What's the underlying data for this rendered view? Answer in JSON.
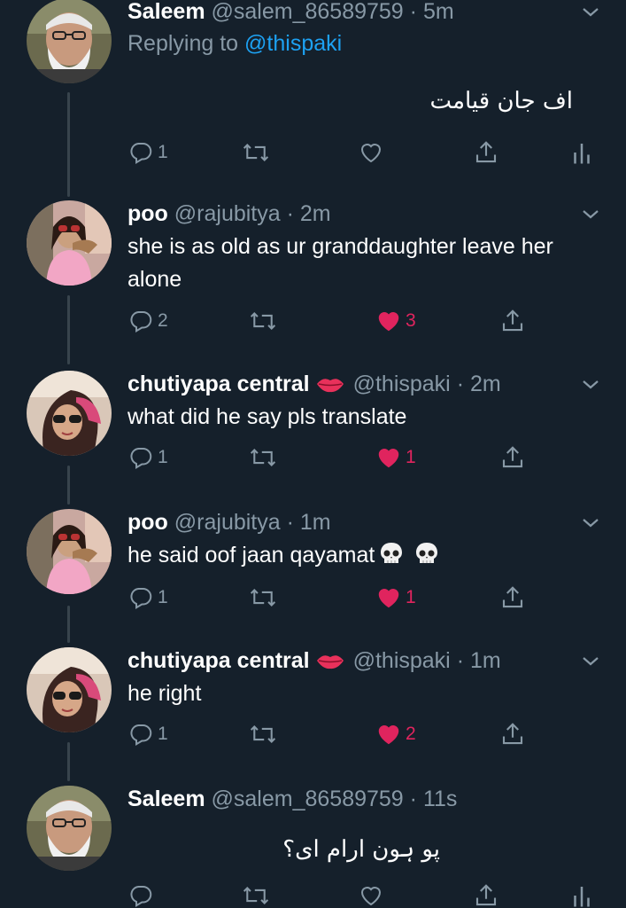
{
  "theme": {
    "background": "#15202b",
    "text_primary": "#ffffff",
    "text_secondary": "#8899a6",
    "link": "#1da1f2",
    "like_active": "#e0245e",
    "thread_line": "#38444d"
  },
  "tweets": [
    {
      "name": "Saleem",
      "handle": "@salem_86589759",
      "dot": "·",
      "time": "5m",
      "reply_prefix": "Replying to",
      "reply_mention": "@thispaki",
      "text": "اف جان قیامت",
      "replies": "1",
      "retweets": "",
      "likes": "",
      "liked": false,
      "avatar": "saleem",
      "action_icons": [
        "reply-icon",
        "retweet-icon",
        "heart-icon",
        "share-icon",
        "analytics-icon"
      ]
    },
    {
      "name": "poo",
      "handle": "@rajubitya",
      "dot": "·",
      "time": "2m",
      "text": "she is as old as ur granddaughter leave her alone",
      "replies": "2",
      "retweets": "",
      "likes": "3",
      "liked": true,
      "avatar": "poo",
      "action_icons": [
        "reply-icon",
        "retweet-icon",
        "heart-filled-icon",
        "share-icon"
      ]
    },
    {
      "name": "chutiyapa central",
      "name_emoji": "lips-emoji",
      "handle": "@thispaki",
      "dot": "·",
      "time": "2m",
      "text": "what did he say pls translate",
      "replies": "1",
      "retweets": "",
      "likes": "1",
      "liked": true,
      "avatar": "chutiyapa",
      "action_icons": [
        "reply-icon",
        "retweet-icon",
        "heart-filled-icon",
        "share-icon"
      ]
    },
    {
      "name": "poo",
      "handle": "@rajubitya",
      "dot": "·",
      "time": "1m",
      "text": "he said oof jaan qayamat",
      "text_emoji": [
        "skull-emoji",
        "skull-emoji"
      ],
      "replies": "1",
      "retweets": "",
      "likes": "1",
      "liked": true,
      "avatar": "poo",
      "action_icons": [
        "reply-icon",
        "retweet-icon",
        "heart-filled-icon",
        "share-icon"
      ]
    },
    {
      "name": "chutiyapa central",
      "name_emoji": "lips-emoji",
      "handle": "@thispaki",
      "dot": "·",
      "time": "1m",
      "text": "he right",
      "replies": "1",
      "retweets": "",
      "likes": "2",
      "liked": true,
      "avatar": "chutiyapa",
      "action_icons": [
        "reply-icon",
        "retweet-icon",
        "heart-filled-icon",
        "share-icon"
      ]
    },
    {
      "name": "Saleem",
      "handle": "@salem_86589759",
      "dot": "·",
      "time": "11s",
      "text": "پو ہون ارام ای؟",
      "replies": "",
      "retweets": "",
      "likes": "",
      "liked": false,
      "avatar": "saleem",
      "action_icons": [
        "reply-icon",
        "retweet-icon",
        "heart-icon",
        "share-icon",
        "analytics-icon"
      ]
    }
  ]
}
